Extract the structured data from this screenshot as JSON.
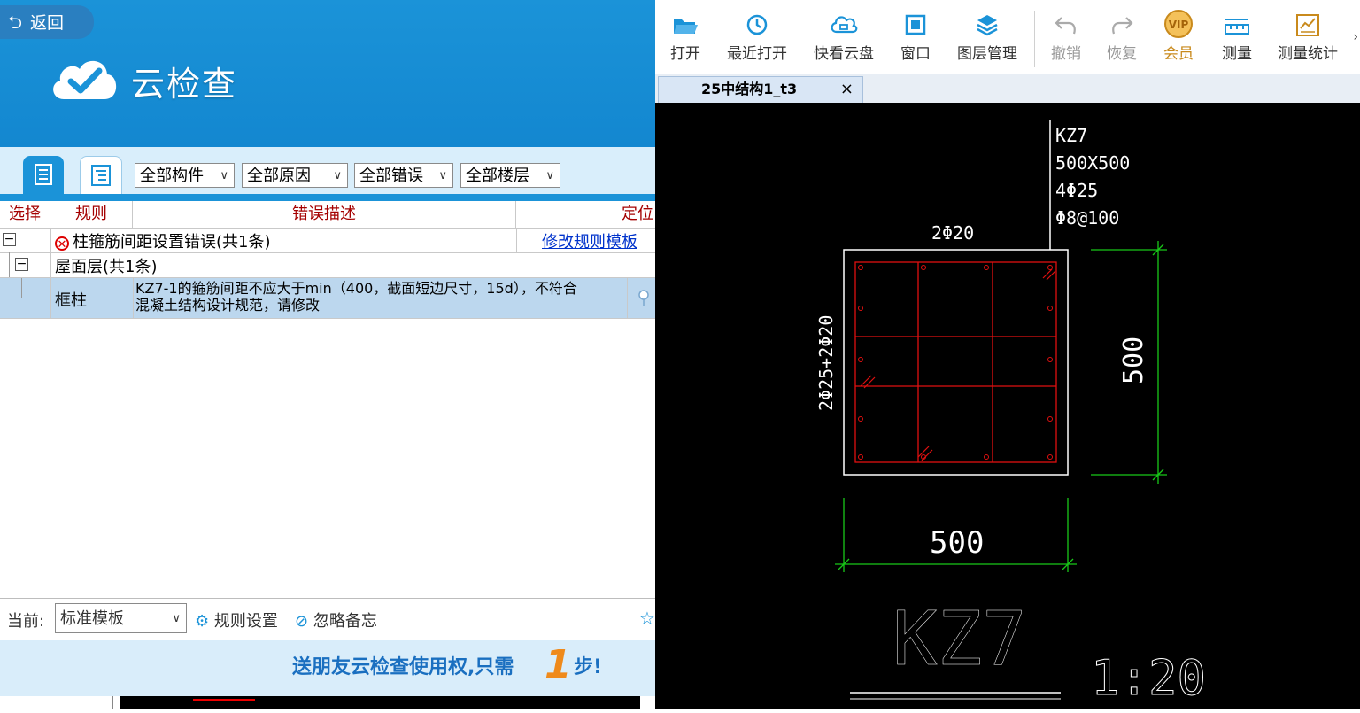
{
  "left_panel": {
    "back_label": "返回",
    "title": "云检查",
    "filters": [
      "全部构件",
      "全部原因",
      "全部错误",
      "全部楼层"
    ],
    "columns": [
      "选择",
      "规则",
      "错误描述",
      "定位"
    ],
    "group": {
      "title": "柱箍筋间距设置错误(共1条)",
      "action_link": "修改规则模板",
      "floor": "屋面层(共1条)",
      "row": {
        "type": "框柱",
        "description_line1": "KZ7-1的箍筋间距不应大于min（400，截面短边尺寸，15d），不符合",
        "description_line2": "混凝土结构设计规范，请修改"
      }
    },
    "bottom": {
      "current_label": "当前:",
      "template_value": "标准模板",
      "rule_settings": "规则设置",
      "ignore_memo": "忽略备忘"
    },
    "banner": {
      "text_before": "送朋友云检查使用权,只需",
      "number": "1",
      "text_after": "步!"
    }
  },
  "viewer": {
    "toolbar": [
      {
        "label": "打开",
        "icon": "folder-open-icon",
        "enabled": true
      },
      {
        "label": "最近打开",
        "icon": "clock-history-icon",
        "enabled": true
      },
      {
        "label": "快看云盘",
        "icon": "cloud-drive-icon",
        "enabled": true
      },
      {
        "label": "窗口",
        "icon": "window-icon",
        "enabled": true
      },
      {
        "label": "图层管理",
        "icon": "layers-icon",
        "enabled": true
      },
      {
        "label": "撤销",
        "icon": "undo-icon",
        "enabled": false
      },
      {
        "label": "恢复",
        "icon": "redo-icon",
        "enabled": false
      },
      {
        "label": "会员",
        "icon": "vip-icon",
        "enabled": true
      },
      {
        "label": "测量",
        "icon": "ruler-icon",
        "enabled": true
      },
      {
        "label": "测量统计",
        "icon": "measure-stats-icon",
        "enabled": true
      }
    ],
    "more": "›",
    "tab": {
      "name": "25中结构1_t3",
      "close": "×"
    },
    "drawing": {
      "leader_lines": [
        "KZ7",
        "500X500",
        "4Φ25",
        "Φ8@100"
      ],
      "top_rebar": "2Φ20",
      "side_rebar": "2Φ25+2Φ20",
      "dim_right": "500",
      "dim_bottom": "500",
      "column_name": "KZ7",
      "scale": "1:20"
    }
  }
}
